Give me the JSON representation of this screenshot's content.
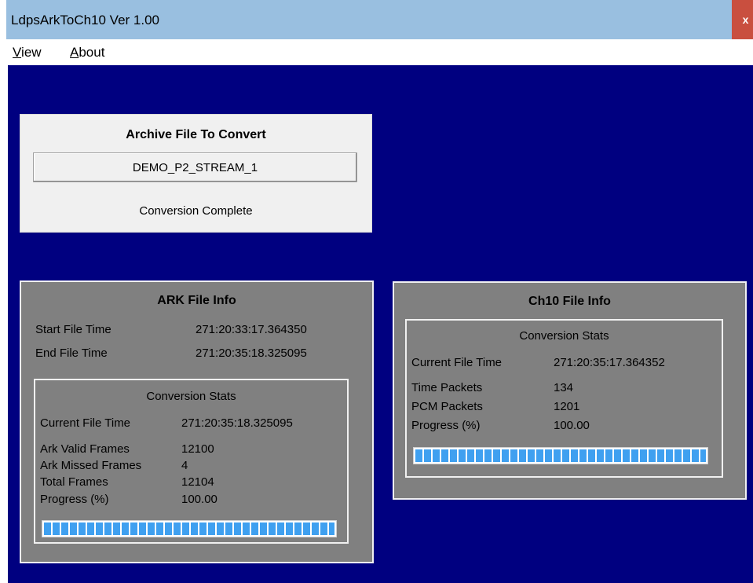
{
  "window": {
    "title": "LdpsArkToCh10 Ver 1.00",
    "close_label": "x"
  },
  "menu": {
    "view_underlined": "V",
    "view_rest": "iew",
    "about_underlined": "A",
    "about_rest": "bout"
  },
  "archive": {
    "heading": "Archive File To Convert",
    "file": "DEMO_P2_STREAM_1",
    "status": "Conversion Complete"
  },
  "ark": {
    "heading": "ARK File Info",
    "start_label": "Start File Time",
    "start_value": "271:20:33:17.364350",
    "end_label": "End File Time",
    "end_value": "271:20:35:18.325095",
    "stats": {
      "heading": "Conversion Stats",
      "current_label": "Current File Time",
      "current_value": "271:20:35:18.325095",
      "valid_label": "Ark Valid Frames",
      "valid_value": "12100",
      "missed_label": "Ark Missed Frames",
      "missed_value": "4",
      "total_label": "Total Frames",
      "total_value": "12104",
      "progress_label": "Progress (%)",
      "progress_value": "100.00",
      "progress_fraction": 1.0
    }
  },
  "ch10": {
    "heading": "Ch10 File Info",
    "stats": {
      "heading": "Conversion Stats",
      "current_label": "Current File Time",
      "current_value": "271:20:35:17.364352",
      "time_label": "Time Packets",
      "time_value": "134",
      "pcm_label": "PCM Packets",
      "pcm_value": "1201",
      "progress_label": "Progress (%)",
      "progress_value": "100.00",
      "progress_fraction": 1.0
    }
  },
  "colors": {
    "client_bg": "#000080",
    "panel_gray": "#808080",
    "progress_fill": "#3fa0f0",
    "titlebar": "#99bfe0",
    "close": "#c94f3f"
  }
}
